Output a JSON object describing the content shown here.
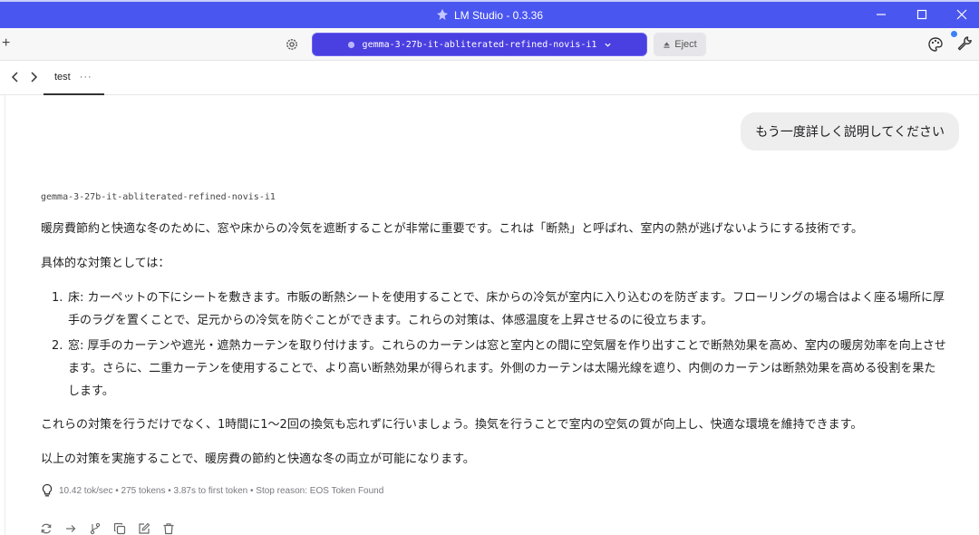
{
  "window": {
    "title": "LM Studio - 0.3.36"
  },
  "toolbar": {
    "model_name": "gemma-3-27b-it-abliterated-refined-novis-i1",
    "eject_label": "Eject"
  },
  "tabs": [
    {
      "label": "test",
      "more": "···"
    }
  ],
  "chat": {
    "user_message": "もう一度詳しく説明してください",
    "model_label": "gemma-3-27b-it-abliterated-refined-novis-i1",
    "paragraph1": "暖房費節約と快適な冬のために、窓や床からの冷気を遮断することが非常に重要です。これは「断熱」と呼ばれ、室内の熱が逃げないようにする技術です。",
    "paragraph2": "具体的な対策としては：",
    "list": [
      {
        "num": "1.",
        "text": "床: カーペットの下にシートを敷きます。市販の断熱シートを使用することで、床からの冷気が室内に入り込むのを防ぎます。フローリングの場合はよく座る場所に厚手のラグを置くことで、足元からの冷気を防ぐことができます。これらの対策は、体感温度を上昇させるのに役立ちます。"
      },
      {
        "num": "2.",
        "text": "窓: 厚手のカーテンや遮光・遮熱カーテンを取り付けます。これらのカーテンは窓と室内との間に空気層を作り出すことで断熱効果を高め、室内の暖房効率を向上させます。さらに、二重カーテンを使用することで、より高い断熱効果が得られます。外側のカーテンは太陽光線を遮り、内側のカーテンは断熱効果を高める役割を果たします。"
      }
    ],
    "paragraph3": "これらの対策を行うだけでなく、1時間に1〜2回の換気も忘れずに行いましょう。換気を行うことで室内の空気の質が向上し、快適な環境を維持できます。",
    "paragraph4": "以上の対策を実施することで、暖房費の節約と快適な冬の両立が可能になります。",
    "stats": "10.42 tok/sec • 275 tokens • 3.87s to first token • Stop reason: EOS Token Found"
  },
  "icons": {
    "logo": "lmstudio-logo-icon",
    "minimize": "minimize-icon",
    "maximize": "maximize-icon",
    "close": "close-icon",
    "new_chat": "plus-icon",
    "settings": "gear-icon",
    "model": "model-icon",
    "dropdown": "chevron-down-icon",
    "eject": "eject-icon",
    "theme": "palette-icon",
    "developer": "wrench-icon",
    "back": "chevron-left-icon",
    "forward": "chevron-right-icon",
    "stats": "lightbulb-icon",
    "regenerate": "regenerate-icon",
    "continue": "arrow-right-icon",
    "branch": "branch-icon",
    "copy": "copy-icon",
    "edit": "edit-icon",
    "delete": "trash-icon"
  },
  "colors": {
    "titlebar": "#4a56f0",
    "model_pill": "#4a3fe0",
    "notification_dot": "#3b82f6"
  }
}
